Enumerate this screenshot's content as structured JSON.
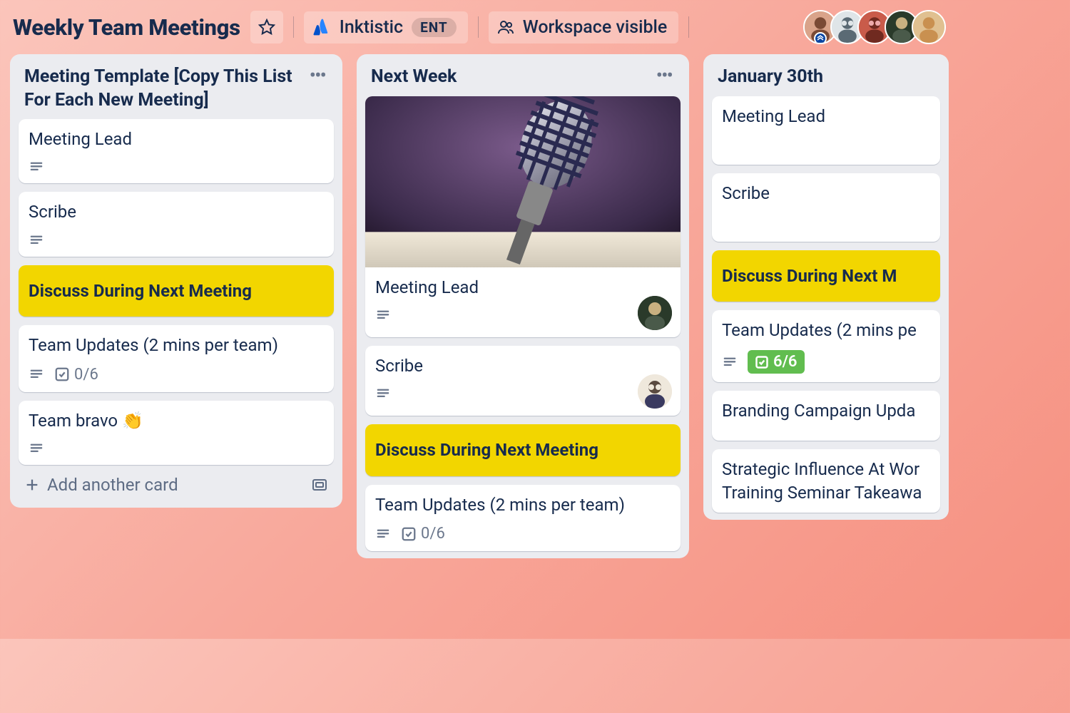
{
  "header": {
    "title": "Weekly Team Meetings",
    "workspace": "Inktistic",
    "workspace_badge": "ENT",
    "visibility": "Workspace visible"
  },
  "avatars": [
    {
      "bg": "#d9a38a"
    },
    {
      "bg": "#8a9aa5"
    },
    {
      "bg": "#c95b4a"
    },
    {
      "bg": "#3a4a3a"
    },
    {
      "bg": "#e0b070"
    }
  ],
  "lists": [
    {
      "title": "Meeting Template [Copy This List For Each New Meeting]",
      "add_label": "Add another card",
      "cards": [
        {
          "title": "Meeting Lead",
          "desc": true
        },
        {
          "title": "Scribe",
          "desc": true
        },
        {
          "title": "Discuss During Next Meeting",
          "style": "yellow"
        },
        {
          "title": "Team Updates (2 mins per team)",
          "desc": true,
          "checklist": "0/6"
        },
        {
          "title": "Team bravo 👏",
          "desc": true
        }
      ]
    },
    {
      "title": "Next Week",
      "cards": [
        {
          "title": "Meeting Lead",
          "desc": true,
          "cover": true,
          "member": 3
        },
        {
          "title": "Scribe",
          "desc": true,
          "member": 1
        },
        {
          "title": "Discuss During Next Meeting",
          "style": "yellow"
        },
        {
          "title": "Team Updates (2 mins per team)",
          "desc": true,
          "checklist": "0/6"
        }
      ]
    },
    {
      "title": "January 30th",
      "cards": [
        {
          "title": "Meeting Lead"
        },
        {
          "title": "Scribe"
        },
        {
          "title": "Discuss During Next M",
          "style": "yellow"
        },
        {
          "title": "Team Updates (2 mins pe",
          "desc": true,
          "checklist": "6/6",
          "checklist_done": true
        },
        {
          "title": "Branding Campaign Upda"
        },
        {
          "title": "Strategic Influence At Wor Training Seminar Takeawa"
        }
      ]
    }
  ]
}
